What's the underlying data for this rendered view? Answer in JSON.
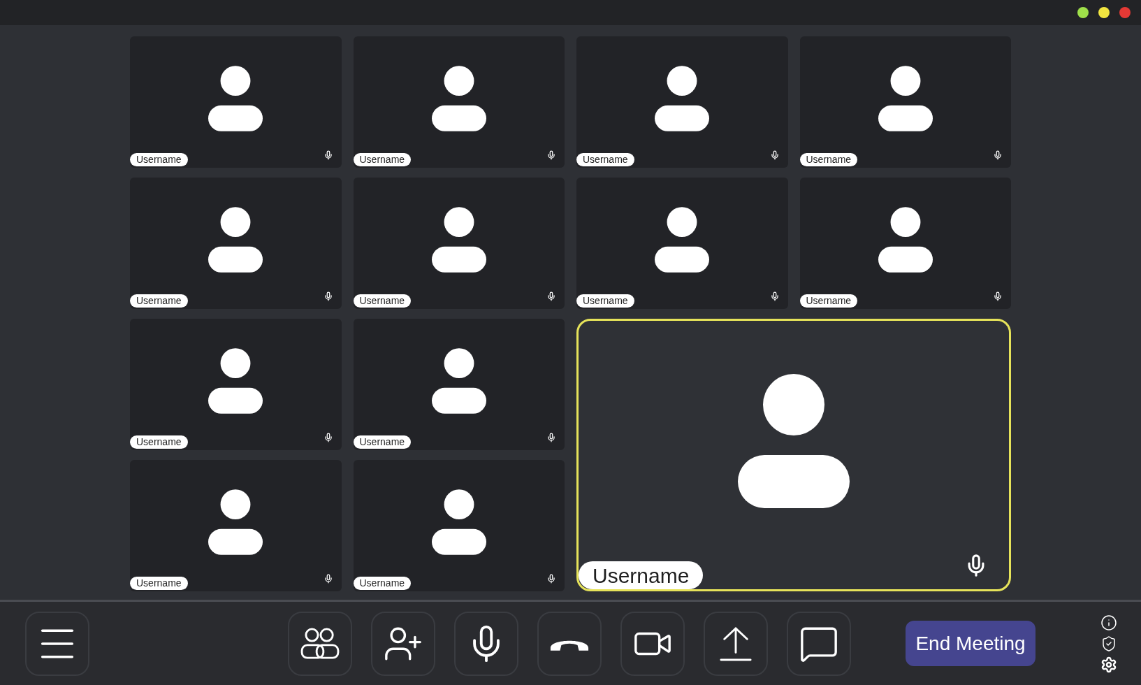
{
  "window_controls": [
    {
      "color": "#9fe04a"
    },
    {
      "color": "#f2e640"
    },
    {
      "color": "#e53935"
    }
  ],
  "tiles": [
    {
      "name": "Username",
      "active": false
    },
    {
      "name": "Username",
      "active": false
    },
    {
      "name": "Username",
      "active": false
    },
    {
      "name": "Username",
      "active": false
    },
    {
      "name": "Username",
      "active": false
    },
    {
      "name": "Username",
      "active": false
    },
    {
      "name": "Username",
      "active": false
    },
    {
      "name": "Username",
      "active": false
    },
    {
      "name": "Username",
      "active": false
    },
    {
      "name": "Username",
      "active": false
    },
    {
      "name": "Username",
      "active": true
    },
    {
      "name": "Username",
      "active": false
    },
    {
      "name": "Username",
      "active": false
    }
  ],
  "toolbar": {
    "tools": [
      {
        "kind": "participants"
      },
      {
        "kind": "add-person"
      },
      {
        "kind": "mic"
      },
      {
        "kind": "hang-up"
      },
      {
        "kind": "video"
      },
      {
        "kind": "share"
      },
      {
        "kind": "chat"
      }
    ],
    "end_button": "End Meeting"
  }
}
